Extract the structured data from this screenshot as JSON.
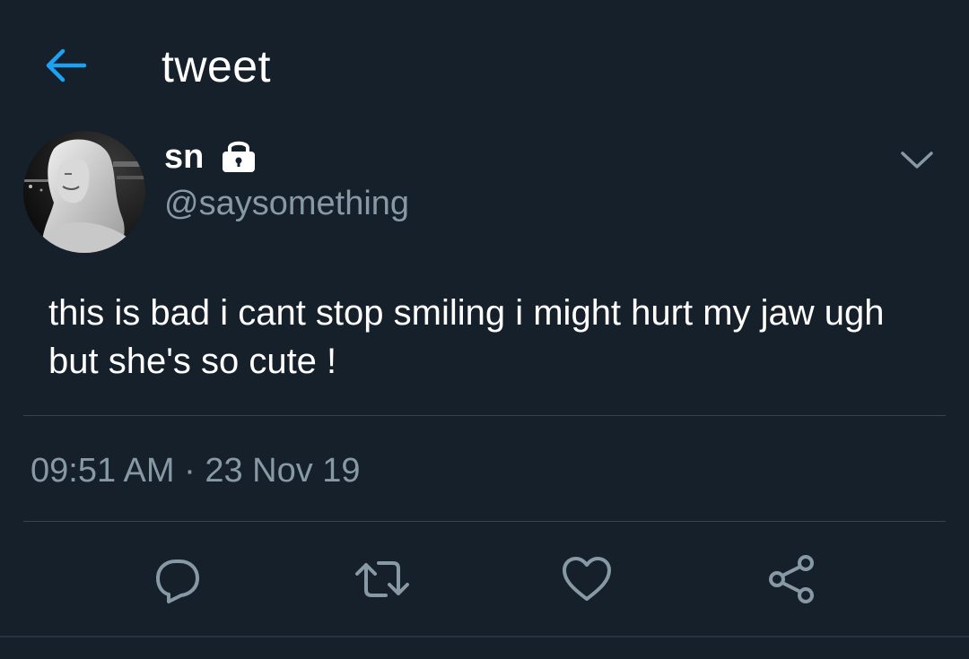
{
  "header": {
    "title": "tweet",
    "back_icon": "arrow-left-icon"
  },
  "tweet": {
    "author": {
      "display_name": "sn",
      "handle": "@saysomething",
      "protected_icon": "lock-icon",
      "avatar": "profile-photo"
    },
    "text": "this is bad i cant stop smiling i might hurt my jaw ugh but she's so cute !",
    "timestamp": "09:51 AM · 23 Nov 19",
    "menu_icon": "chevron-down-icon"
  },
  "actions": [
    {
      "name": "reply",
      "icon": "reply-icon"
    },
    {
      "name": "retweet",
      "icon": "retweet-icon"
    },
    {
      "name": "like",
      "icon": "heart-icon"
    },
    {
      "name": "share",
      "icon": "share-icon"
    }
  ],
  "colors": {
    "background": "#15202b",
    "accent": "#1da1f2",
    "secondary_text": "#8899a6",
    "divider": "#38444d"
  }
}
